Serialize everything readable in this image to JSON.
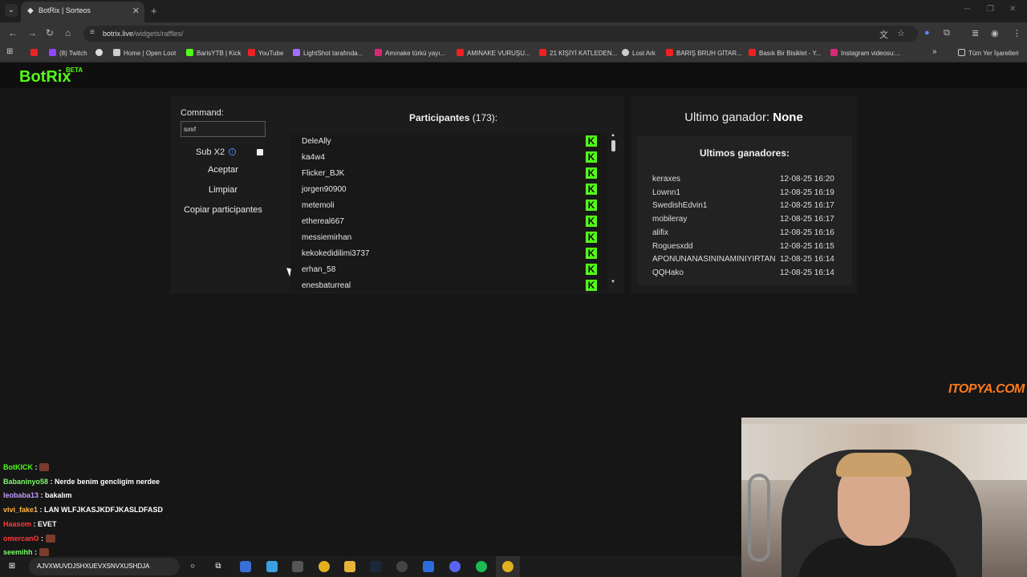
{
  "browser": {
    "tab_title": "BotRix | Sorteos",
    "url_host": "botrix.live",
    "url_path": "/widgets/raffles/",
    "bookmarks": [
      "(8) Twitch",
      "Home | Open Loot",
      "BarisYTB | Kick",
      "YouTube",
      "LightShot tarafında...",
      "Amınake türkü yayı...",
      "AMINAKE VURUŞU...",
      "21 KİŞİYİ KATLEDEN...",
      "Lost Ark",
      "BARIŞ BRUH GİTAR...",
      "Basık Bir Bisiklet - Y...",
      "Instagram videosu:..."
    ],
    "bookmarks_folder": "Tüm Yer İşaretleri"
  },
  "site": {
    "logo": "BotRix",
    "beta": "BETA"
  },
  "controls": {
    "command_label": "Command:",
    "command_value": "sınıf",
    "subx2_label": "Sub X2",
    "subx2_info": "i",
    "accept": "Aceptar",
    "clear": "Limpiar",
    "copy": "Copiar participantes"
  },
  "participants": {
    "title": "Participantes",
    "count": "(173):",
    "platform_letter": "K",
    "names": [
      "DeleAlly",
      "ka4w4",
      "Flicker_BJK",
      "jorgen90900",
      "metemoli",
      "ethereal667",
      "messiemirhan",
      "kekokedidilimi3737",
      "erhan_58",
      "enesbaturreal"
    ]
  },
  "winners": {
    "last_label": "Ultimo ganador:",
    "last_value": "None",
    "list_title": "Ultimos ganadores:",
    "list": [
      {
        "name": "keraxes",
        "time": "12-08-25 16:20"
      },
      {
        "name": "Lownn1",
        "time": "12-08-25 16:19"
      },
      {
        "name": "SwedishEdvin1",
        "time": "12-08-25 16:17"
      },
      {
        "name": "mobileray",
        "time": "12-08-25 16:17"
      },
      {
        "name": "alifix",
        "time": "12-08-25 16:16"
      },
      {
        "name": "Roguesxdd",
        "time": "12-08-25 16:15"
      },
      {
        "name": "APONUNANASININAMINIYIRTAN",
        "time": "12-08-25 16:14"
      },
      {
        "name": "QQHako",
        "time": "12-08-25 16:14"
      }
    ]
  },
  "overlay": {
    "watermark": "ITOPYA.COM",
    "chat": [
      {
        "user": "BotKICK",
        "text": "",
        "color": "#53fc18"
      },
      {
        "user": "Babaninyo58",
        "text": "Nerde benim gencligim nerdee",
        "color": "#7cfc6a"
      },
      {
        "user": "leobaba13",
        "text": "bakalım",
        "color": "#c39bff"
      },
      {
        "user": "vivi_fake1",
        "text": "LAN WLFJKASJKDFJKASLDFASD",
        "color": "#ffb347"
      },
      {
        "user": "Haasom",
        "text": "EVET",
        "color": "#ff3b3b"
      },
      {
        "user": "omercanO",
        "text": "",
        "color": "#ff3b3b"
      },
      {
        "user": "seemihh",
        "text": "",
        "color": "#7cfc6a"
      }
    ],
    "taskbar_search": "AJVXWUVDJSHXUEVXSNVXUSHDJA"
  },
  "colors": {
    "kick_green": "#53fc18",
    "panel_bg": "#1c1c1c",
    "page_bg": "#161616"
  }
}
